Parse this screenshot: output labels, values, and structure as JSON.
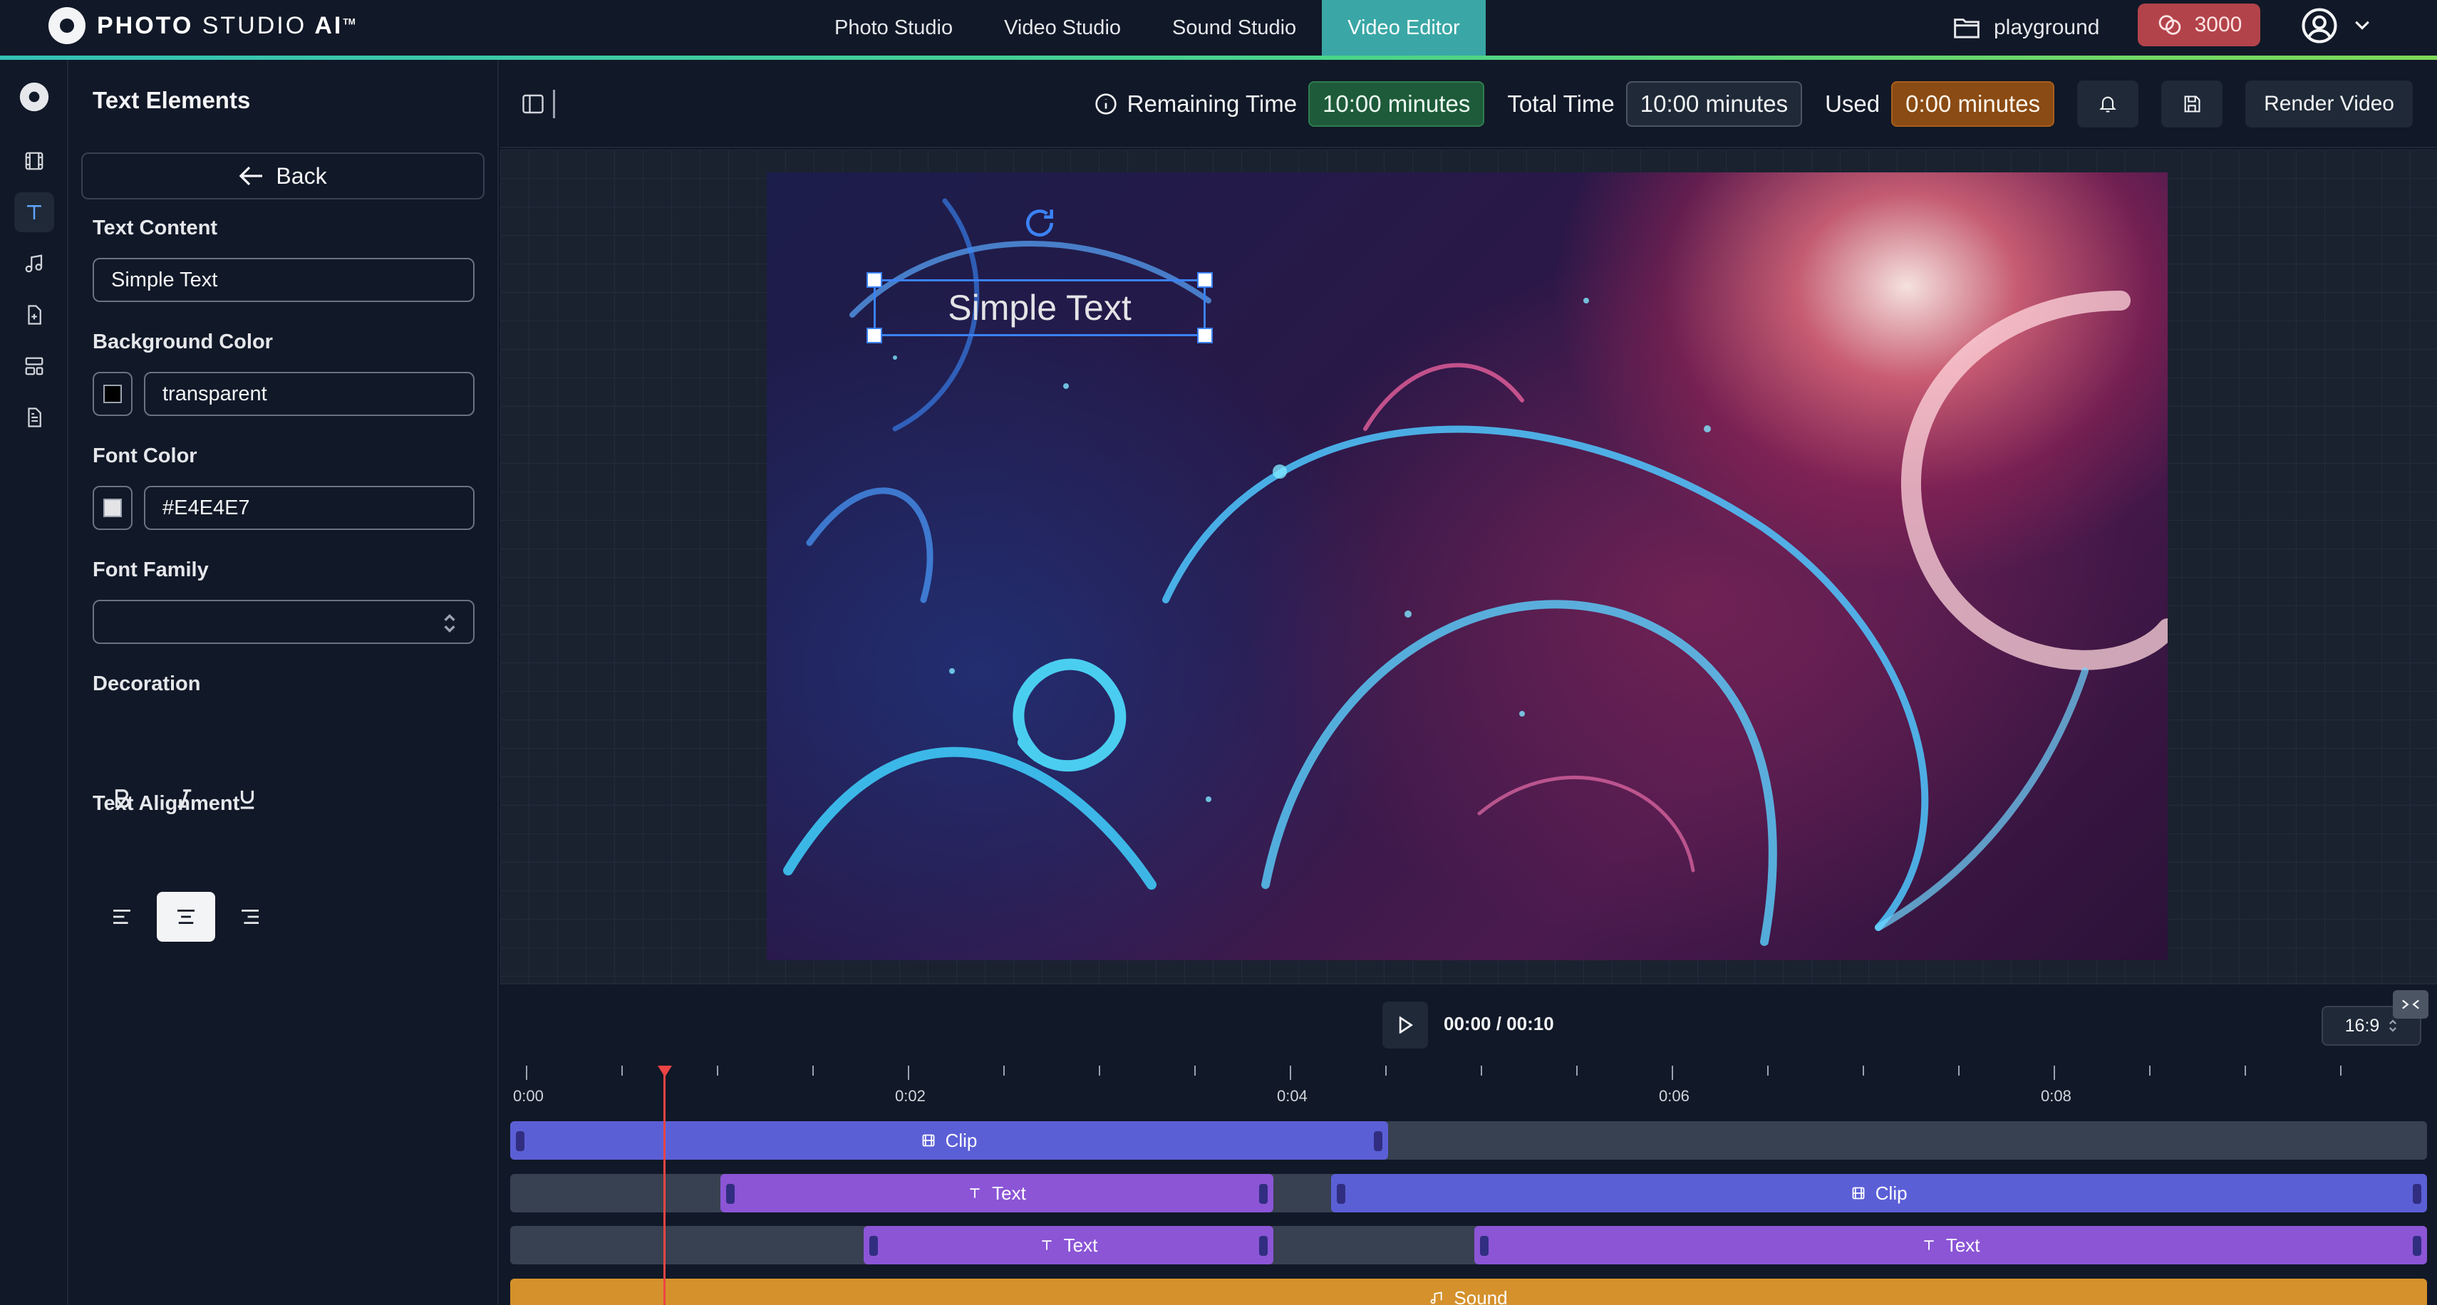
{
  "app": {
    "logo_main": "PHOTO",
    "logo_studio": "STUDIO",
    "logo_ai": "AI",
    "logo_tm": "TM"
  },
  "nav": {
    "items": [
      {
        "label": "Photo Studio",
        "active": false
      },
      {
        "label": "Video Studio",
        "active": false
      },
      {
        "label": "Sound Studio",
        "active": false
      },
      {
        "label": "Video Editor",
        "active": true
      }
    ]
  },
  "project": {
    "name": "playground",
    "icon": "folder-icon"
  },
  "credits": {
    "value": "3000",
    "icon": "coins-icon"
  },
  "rail": {
    "items": [
      "video-icon",
      "text-icon",
      "music-icon",
      "file-plus-icon",
      "layout-icon",
      "document-icon"
    ],
    "active": "text-icon"
  },
  "panel": {
    "title": "Text Elements",
    "back_label": "Back",
    "text_content_label": "Text Content",
    "text_content_value": "Simple Text",
    "bg_color_label": "Background Color",
    "bg_color_value": "transparent",
    "bg_swatch": "#000000",
    "font_color_label": "Font Color",
    "font_color_value": "#E4E4E7",
    "font_swatch": "#E4E4E7",
    "font_family_label": "Font Family",
    "font_family_value": "",
    "decoration_label": "Decoration",
    "decoration_buttons": [
      "B",
      "I",
      "U"
    ],
    "alignment_label": "Text Alignment",
    "alignment_active": "center"
  },
  "header": {
    "remaining_label": "Remaining Time",
    "remaining_value": "10:00 minutes",
    "total_label": "Total Time",
    "total_value": "10:00 minutes",
    "used_label": "Used",
    "used_value": "0:00 minutes",
    "render_label": "Render Video"
  },
  "canvas": {
    "overlay_text": "Simple Text"
  },
  "player": {
    "time": "00:00 / 00:10",
    "aspect_ratio": "16:9"
  },
  "timeline": {
    "tick_labels": [
      "0:00",
      "0:02",
      "0:04",
      "0:06",
      "0:08"
    ],
    "tracks": [
      [
        {
          "type": "video",
          "label": "Clip",
          "start": 0.0,
          "end": 4.5
        }
      ],
      [
        {
          "type": "text",
          "label": "Text",
          "start": 1.1,
          "end": 3.9
        },
        {
          "type": "video",
          "label": "Clip",
          "start": 4.3,
          "end": 10.0
        }
      ],
      [
        {
          "type": "text",
          "label": "Text",
          "start": 1.85,
          "end": 3.9
        },
        {
          "type": "text",
          "label": "Text",
          "start": 5.05,
          "end": 10.0
        }
      ],
      [
        {
          "type": "sound",
          "label": "Sound",
          "start": 0.0,
          "end": 10.0
        }
      ]
    ],
    "duration_seconds": 10,
    "playhead_seconds": 0.75
  },
  "colors": {
    "accent": "#3aa7a6",
    "video_clip": "#5b5fd6",
    "text_clip": "#8b55d6",
    "sound_clip": "#d4912c",
    "playhead": "#ef4444"
  }
}
